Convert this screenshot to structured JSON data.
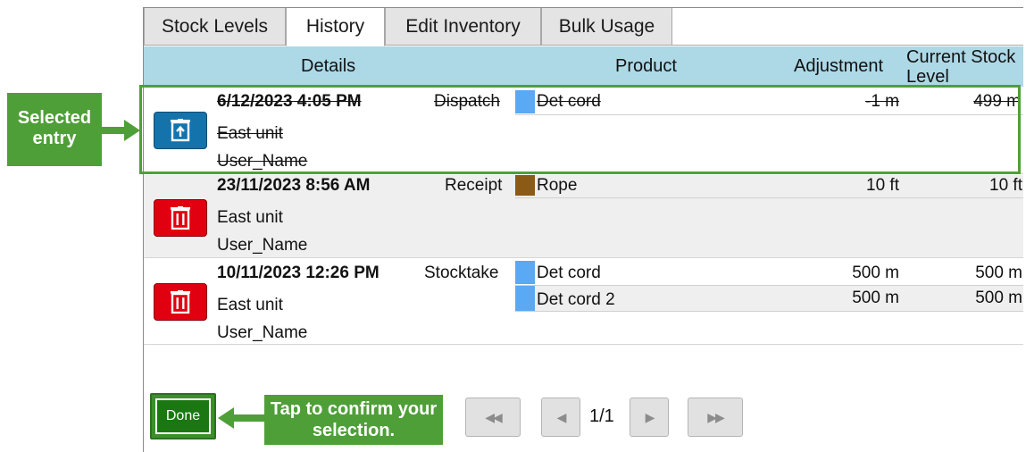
{
  "tabs": [
    {
      "label": "Stock Levels",
      "active": false
    },
    {
      "label": "History",
      "active": true
    },
    {
      "label": "Edit Inventory",
      "active": false
    },
    {
      "label": "Bulk Usage",
      "active": false
    }
  ],
  "columns": {
    "details": "Details",
    "product": "Product",
    "adjustment": "Adjustment",
    "current_stock_level": "Current Stock Level"
  },
  "entries": [
    {
      "date": "6/12/2023 4:05 PM",
      "type": "Dispatch",
      "location": "East unit",
      "user": "User_Name",
      "selected": true,
      "action_icon": "restore-icon",
      "action_color": "#1573ac",
      "products": [
        {
          "name": "Det cord",
          "color": "#5aa9f5",
          "adjustment": "-1 m",
          "level": "499 m"
        }
      ]
    },
    {
      "date": "23/11/2023 8:56 AM",
      "type": "Receipt",
      "location": "East unit",
      "user": "User_Name",
      "selected": false,
      "action_icon": "trash-icon",
      "action_color": "#e1000f",
      "products": [
        {
          "name": "Rope",
          "color": "#8b5a14",
          "adjustment": "10 ft",
          "level": "10 ft"
        }
      ]
    },
    {
      "date": "10/11/2023 12:26 PM",
      "type": "Stocktake",
      "location": "East unit",
      "user": "User_Name",
      "selected": false,
      "action_icon": "trash-icon",
      "action_color": "#e1000f",
      "products": [
        {
          "name": "Det cord",
          "color": "#5aa9f5",
          "adjustment": "500 m",
          "level": "500 m"
        },
        {
          "name": "Det cord 2",
          "color": "#5aa9f5",
          "adjustment": "500 m",
          "level": "500 m"
        }
      ]
    }
  ],
  "pagination": {
    "page_text": "1/1"
  },
  "done_label": "Done",
  "callouts": {
    "selected_entry": "Selected entry",
    "tap_confirm": "Tap to confirm your selection."
  },
  "colors": {
    "header": "#add8e6",
    "highlight": "#4f9f38",
    "done": "#1b7712"
  }
}
